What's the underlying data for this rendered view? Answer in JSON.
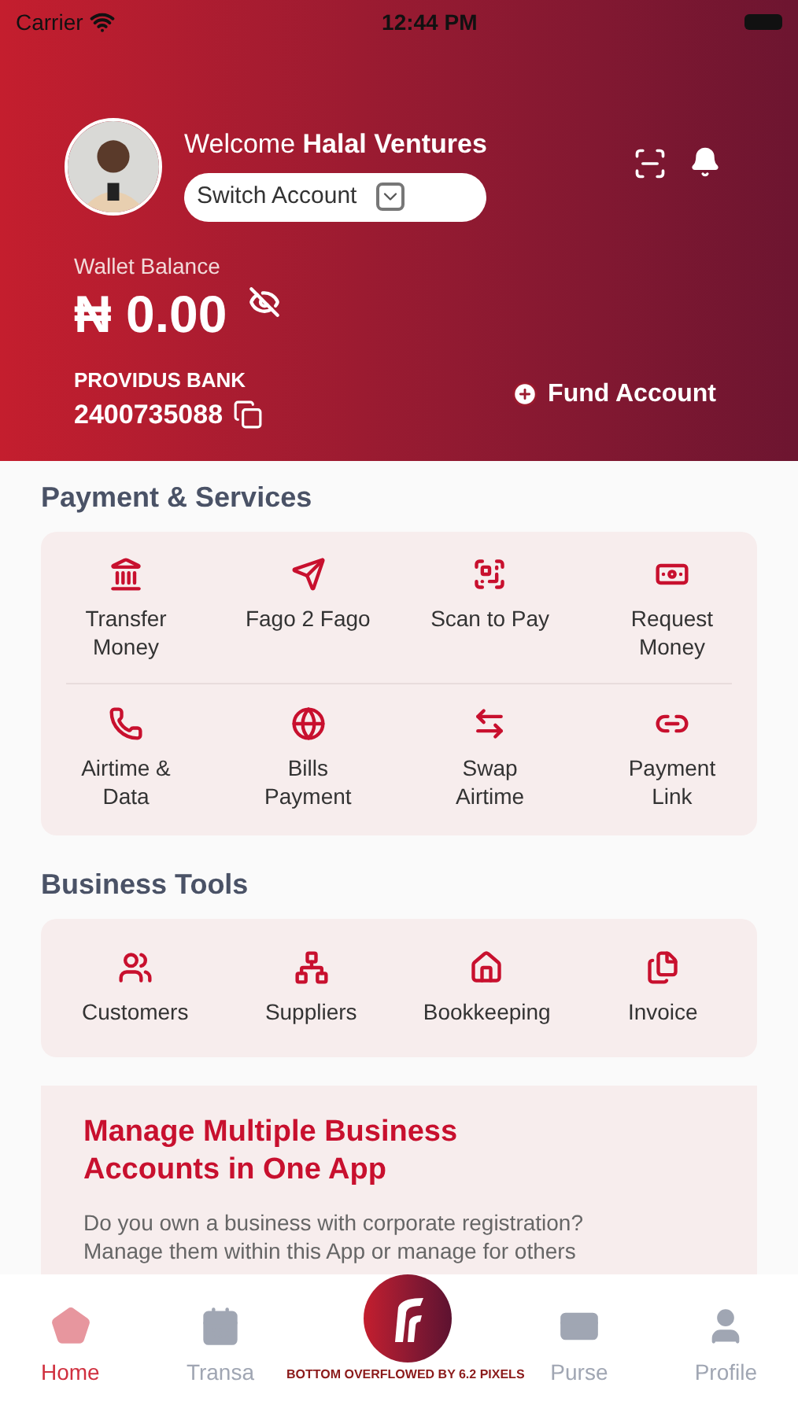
{
  "status_bar": {
    "carrier": "Carrier",
    "time": "12:44 PM"
  },
  "header": {
    "welcome": "Welcome **Halal Ventures**",
    "switch_account": "Switch Account",
    "wallet_label": "Wallet Balance",
    "balance": "₦ 0.00",
    "bank": "PROVIDUS BANK",
    "account_number": "2400735088",
    "fund_account": "Fund Account"
  },
  "payment_services": {
    "title": "Payment & Services",
    "items": [
      {
        "label": "Transfer Money"
      },
      {
        "label": "Fago 2 Fago"
      },
      {
        "label": "Scan to Pay"
      },
      {
        "label": "Request Money"
      },
      {
        "label": "Airtime & Data"
      },
      {
        "label": "Bills Payment"
      },
      {
        "label": "Swap Airtime"
      },
      {
        "label": "Payment Link"
      }
    ]
  },
  "business_tools": {
    "title": "Business Tools",
    "items": [
      {
        "label": "Customers"
      },
      {
        "label": "Suppliers"
      },
      {
        "label": "Bookkeeping"
      },
      {
        "label": "Invoice"
      }
    ]
  },
  "promo": {
    "title": "Manage Multiple Business Accounts in One App",
    "text": "Do you own a business with corporate registration? Manage them within this App or manage for others"
  },
  "bottom_nav": [
    {
      "label": "Home",
      "selected": true
    },
    {
      "label": "Transa",
      "selected": false
    },
    {
      "label": "Purse",
      "selected": false
    },
    {
      "label": "Profile",
      "selected": false
    }
  ],
  "overflow_banner": "BOTTOM OVERFLOWED BY 6.2 PIXELS"
}
